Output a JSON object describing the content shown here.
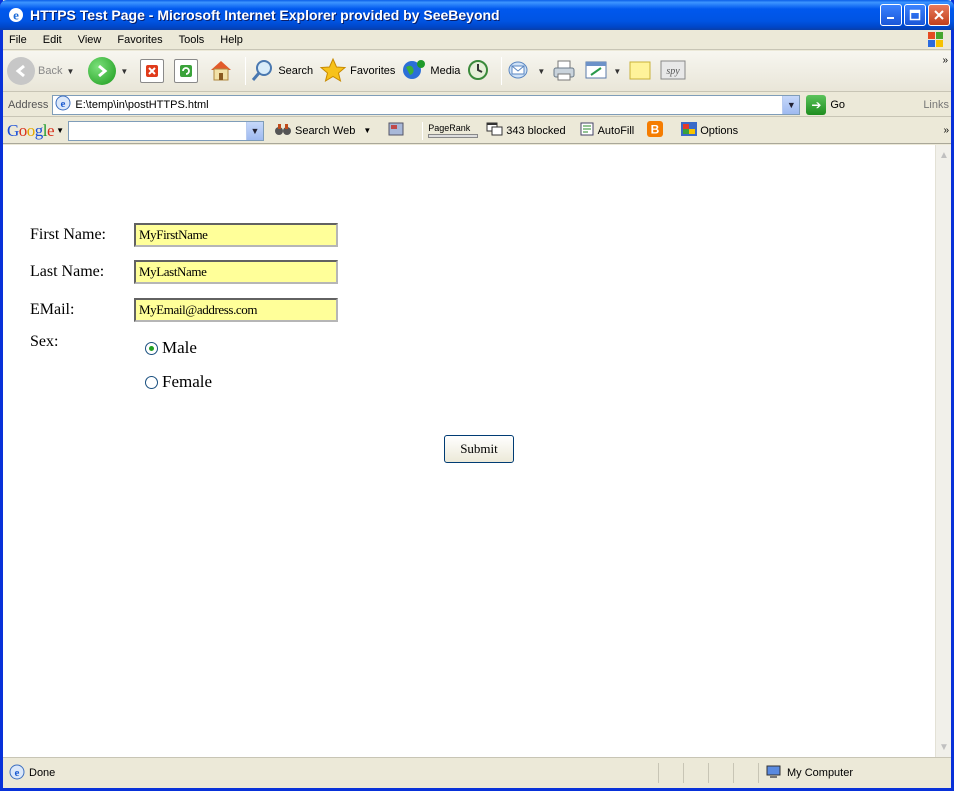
{
  "window": {
    "title": "HTTPS Test Page - Microsoft Internet Explorer provided by SeeBeyond"
  },
  "menu": {
    "items": [
      "File",
      "Edit",
      "View",
      "Favorites",
      "Tools",
      "Help"
    ]
  },
  "toolbar": {
    "back_label": "Back",
    "search_label": "Search",
    "favorites_label": "Favorites",
    "media_label": "Media",
    "more": "»"
  },
  "address": {
    "label": "Address",
    "url": "E:\\temp\\in\\postHTTPS.html",
    "go_label": "Go",
    "links_label": "Links"
  },
  "google": {
    "logo": [
      "G",
      "o",
      "o",
      "g",
      "l",
      "e"
    ],
    "search_web": "Search Web",
    "pagerank": "PageRank",
    "blocked": "343 blocked",
    "autofill": "AutoFill",
    "options": "Options",
    "more": "»"
  },
  "form": {
    "first_name_label": "First Name:",
    "first_name_value": "MyFirstName",
    "last_name_label": "Last Name:",
    "last_name_value": "MyLastName",
    "email_label": "EMail:",
    "email_value": "MyEmail@address.com",
    "sex_label": "Sex:",
    "male_label": "Male",
    "female_label": "Female",
    "selected_sex": "Male",
    "submit_label": "Submit"
  },
  "status": {
    "text": "Done",
    "zone": "My Computer"
  },
  "colors": {
    "field_background": "#ffff99",
    "title_bar": "#0054e3"
  }
}
